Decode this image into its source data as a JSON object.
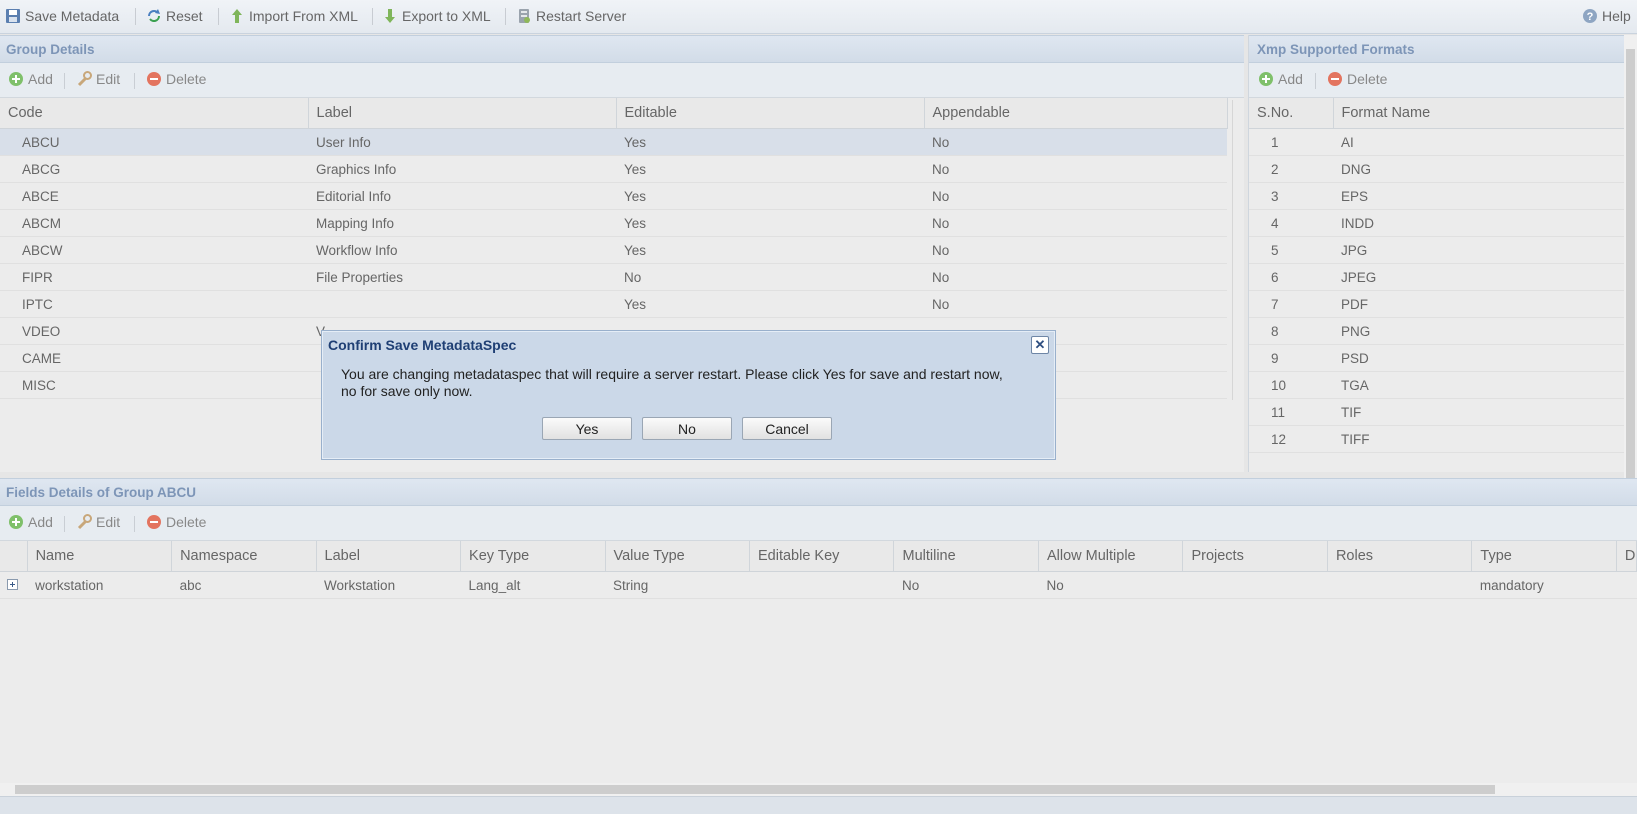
{
  "toolbar": {
    "save_metadata": "Save Metadata",
    "reset": "Reset",
    "import_xml": "Import From XML",
    "export_xml": "Export to XML",
    "restart_server": "Restart Server",
    "help": "Help"
  },
  "group_details": {
    "title": "Group Details",
    "add": "Add",
    "edit": "Edit",
    "delete": "Delete",
    "columns": [
      "Code",
      "Label",
      "Editable",
      "Appendable"
    ],
    "rows": [
      [
        "ABCU",
        "User Info",
        "Yes",
        "No"
      ],
      [
        "ABCG",
        "Graphics Info",
        "Yes",
        "No"
      ],
      [
        "ABCE",
        "Editorial Info",
        "Yes",
        "No"
      ],
      [
        "ABCM",
        "Mapping Info",
        "Yes",
        "No"
      ],
      [
        "ABCW",
        "Workflow Info",
        "Yes",
        "No"
      ],
      [
        "FIPR",
        "File Properties",
        "No",
        "No"
      ],
      [
        "IPTC",
        "",
        "Yes",
        "No"
      ],
      [
        "VDEO",
        "V",
        "",
        ""
      ],
      [
        "CAME",
        "",
        "",
        ""
      ],
      [
        "MISC",
        "",
        "",
        ""
      ]
    ]
  },
  "xmp_formats": {
    "title": "Xmp Supported Formats",
    "add": "Add",
    "delete": "Delete",
    "columns": [
      "S.No.",
      "Format Name"
    ],
    "rows": [
      [
        "1",
        "AI"
      ],
      [
        "2",
        "DNG"
      ],
      [
        "3",
        "EPS"
      ],
      [
        "4",
        "INDD"
      ],
      [
        "5",
        "JPG"
      ],
      [
        "6",
        "JPEG"
      ],
      [
        "7",
        "PDF"
      ],
      [
        "8",
        "PNG"
      ],
      [
        "9",
        "PSD"
      ],
      [
        "10",
        "TGA"
      ],
      [
        "11",
        "TIF"
      ],
      [
        "12",
        "TIFF"
      ]
    ]
  },
  "fields_details": {
    "title": "Fields Details of Group ABCU",
    "add": "Add",
    "edit": "Edit",
    "delete": "Delete",
    "columns": [
      "Name",
      "Namespace",
      "Label",
      "Key Type",
      "Value Type",
      "Editable Key",
      "Multiline",
      "Allow Multiple",
      "Projects",
      "Roles",
      "Type",
      "D"
    ],
    "rows": [
      [
        "workstation",
        "abc",
        "Workstation",
        "Lang_alt",
        "String",
        "",
        "No",
        "No",
        "",
        "",
        "mandatory",
        ""
      ]
    ]
  },
  "dialog": {
    "title": "Confirm Save MetadataSpec",
    "message": "You are changing metadataspec that will require a server restart. Please click Yes for save and restart now, no for save only now.",
    "yes": "Yes",
    "no": "No",
    "cancel": "Cancel"
  }
}
